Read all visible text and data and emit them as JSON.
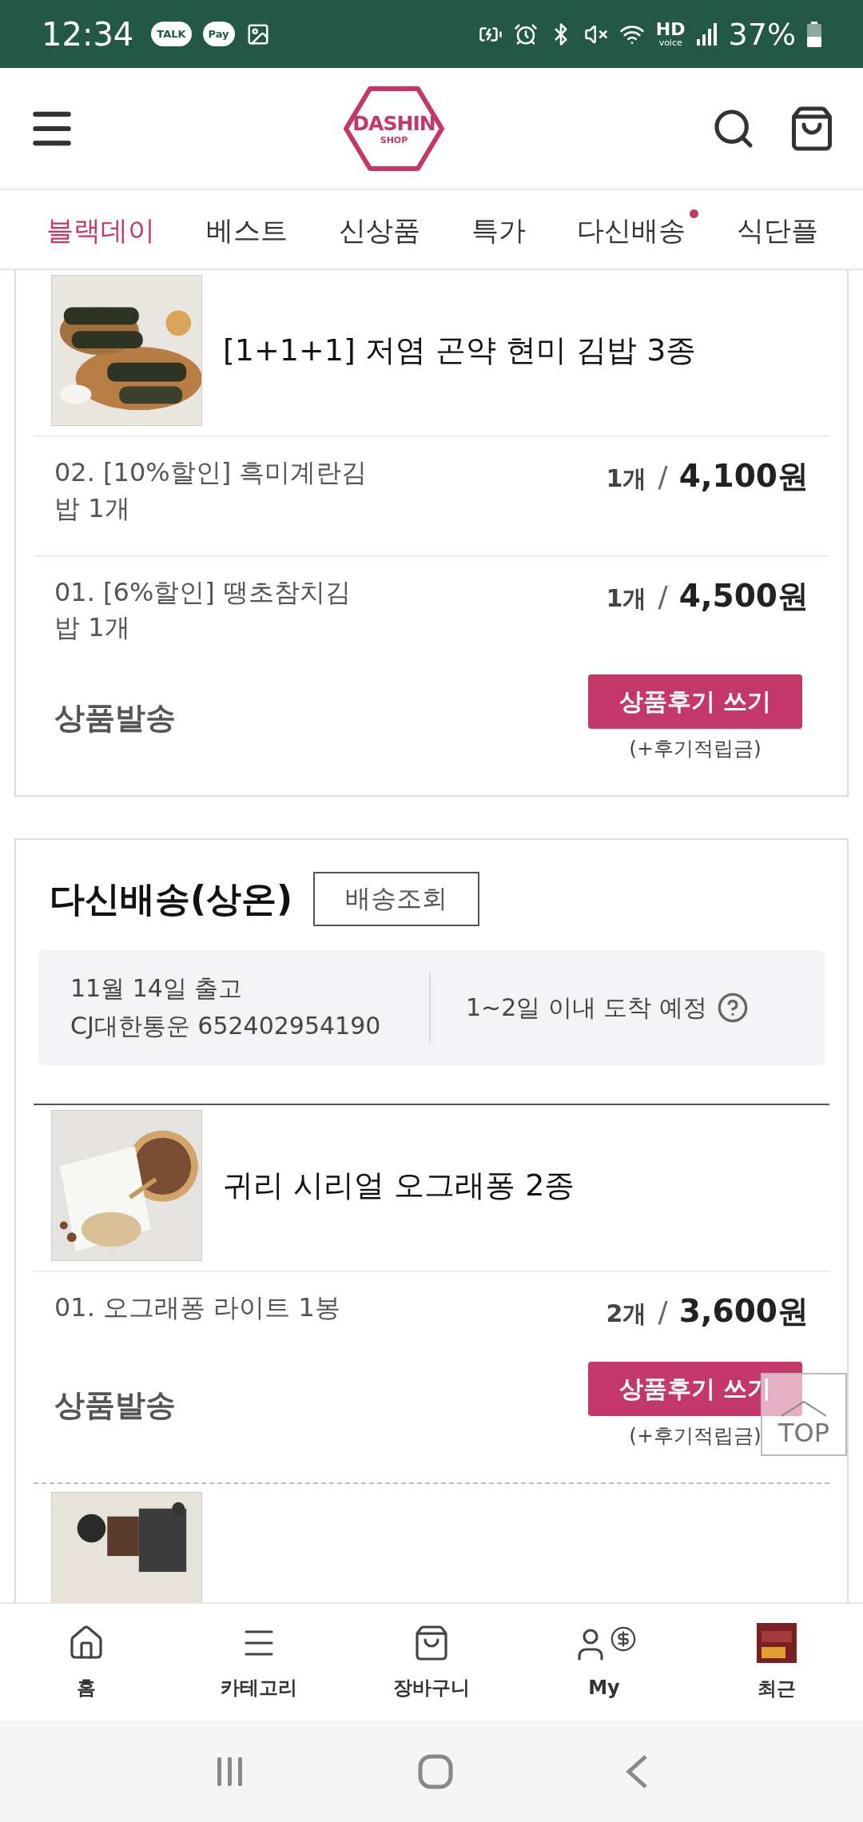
{
  "status_bar": {
    "time": "12:34",
    "talk": "TALK",
    "pay": "Pay",
    "hd": "HD",
    "hd_sub": "voice",
    "battery": "37%"
  },
  "header": {
    "logo_main": "DASHIN",
    "logo_sub": "SHOP"
  },
  "tabs": [
    {
      "label": "블랙데이",
      "selected": true,
      "dot": false
    },
    {
      "label": "베스트",
      "selected": false,
      "dot": false
    },
    {
      "label": "신상품",
      "selected": false,
      "dot": false
    },
    {
      "label": "특가",
      "selected": false,
      "dot": false
    },
    {
      "label": "다신배송",
      "selected": false,
      "dot": true
    },
    {
      "label": "식단플",
      "selected": false,
      "dot": false
    }
  ],
  "orders": [
    {
      "products": [
        {
          "kind": "full",
          "name": "[1+1+1] 저염 곤약 현미 김밥 3종",
          "options": [
            {
              "label": "02. [10%할인] 흑미계란김밥 1개",
              "qty": "1개",
              "separator": "/",
              "price": "4,100원"
            },
            {
              "label": "01. [6%할인] 땡초참치김밥 1개",
              "qty": "1개",
              "separator": "/",
              "price": "4,500원"
            }
          ],
          "status": "상품발송",
          "review_button": "상품후기 쓰기",
          "review_note": "(+후기적립금)"
        }
      ]
    },
    {
      "title": "다신배송(상온)",
      "track_button": "배송조회",
      "shipment": {
        "date": "11월 14일 출고",
        "courier": "CJ대한통운 652402954190",
        "eta": "1~2일 이내 도착 예정"
      },
      "products": [
        {
          "kind": "full",
          "name": "귀리 시리얼 오그래퐁 2종",
          "options": [
            {
              "label": "01. 오그래퐁 라이트 1봉",
              "qty": "2개",
              "separator": "/",
              "price": "3,600원"
            }
          ],
          "status": "상품발송",
          "review_button": "상품후기 쓰기",
          "review_note": "(+후기적립금)"
        },
        {
          "kind": "cut"
        }
      ]
    }
  ],
  "top_button": "TOP",
  "bottom_nav": [
    {
      "label": "홈"
    },
    {
      "label": "카테고리"
    },
    {
      "label": "장바구니"
    },
    {
      "label": "My"
    },
    {
      "label": "최근"
    }
  ]
}
